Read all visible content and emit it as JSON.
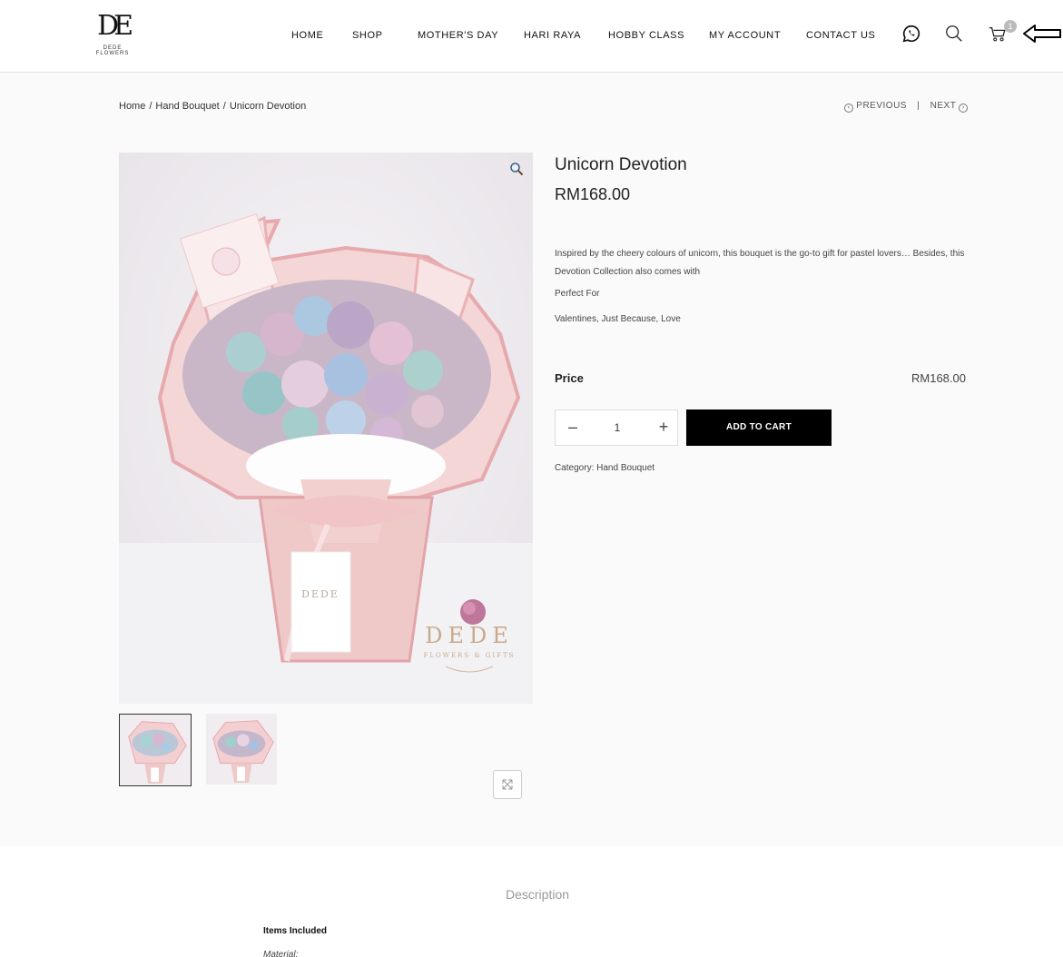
{
  "header": {
    "logo_mark": "DE",
    "logo_text": "DEDE FLOWERS",
    "nav": [
      "HOME",
      "SHOP",
      "MOTHER'S DAY",
      "HARI RAYA",
      "HOBBY CLASS",
      "MY ACCOUNT",
      "CONTACT US"
    ],
    "cart_count": "1",
    "icons": [
      "whatsapp-icon",
      "search-icon",
      "cart-icon"
    ]
  },
  "breadcrumb": {
    "home": "Home",
    "category": "Hand Bouquet",
    "current": "Unicorn Devotion"
  },
  "product_nav": {
    "previous": "PREVIOUS",
    "next": "NEXT",
    "divider": "|"
  },
  "product": {
    "title": "Unicorn Devotion",
    "price": "RM168.00",
    "description": "Inspired by the cheery colours of unicorn, this bouquet is the go-to gift for pastel lovers… Besides, this Devotion Collection also comes with",
    "perfect_for_label": "Perfect For",
    "perfect_for_value": "Valentines, Just Because, Love",
    "price_label": "Price",
    "price_value": "RM168.00",
    "quantity": "1",
    "add_to_cart": "ADD TO CART",
    "category_label": "Category:",
    "category_value": "Hand Bouquet",
    "image_watermark": "DEDE",
    "image_watermark_sub": "FLOWERS & GIFTS",
    "card_text": "DEDE"
  },
  "tabs": {
    "description": "Description"
  },
  "details": {
    "items_included": "Items Included",
    "material": "Material:"
  },
  "colors": {
    "accent_black": "#000000",
    "wrap_pink": "#e9b9bb",
    "badge_gray": "#bbbbbb"
  }
}
